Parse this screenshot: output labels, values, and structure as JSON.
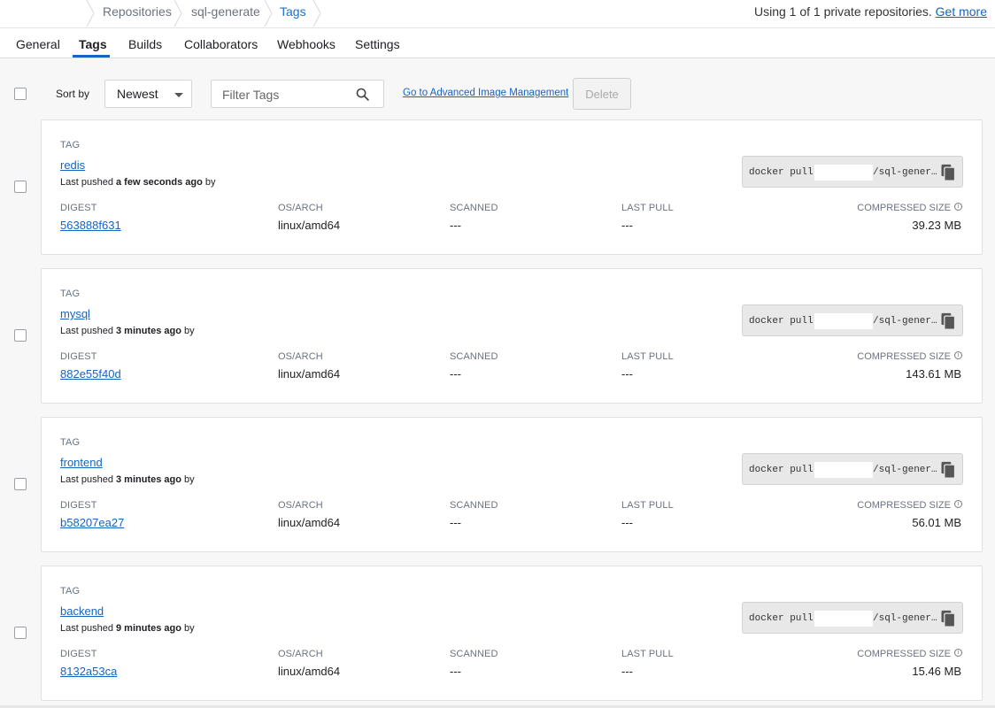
{
  "breadcrumb": {
    "items": [
      "Repositories",
      "sql-generate",
      "Tags"
    ]
  },
  "quota": {
    "text": "Using 1 of 1 private repositories.",
    "link": "Get more"
  },
  "tabs": [
    "General",
    "Tags",
    "Builds",
    "Collaborators",
    "Webhooks",
    "Settings"
  ],
  "active_tab": "Tags",
  "toolbar": {
    "sort_label": "Sort by",
    "sort_value": "Newest",
    "filter_placeholder": "Filter Tags",
    "advanced_link": "Go to Advanced Image Management",
    "delete_label": "Delete"
  },
  "labels": {
    "tag": "TAG",
    "pushed_prefix": "Last pushed",
    "pushed_suffix": "by",
    "digest": "DIGEST",
    "os_arch": "OS/ARCH",
    "scanned": "SCANNED",
    "last_pull": "LAST PULL",
    "compressed_size": "COMPRESSED SIZE",
    "pull_cmd": "docker pull",
    "pull_repo": "/sql-gener…"
  },
  "tags": [
    {
      "name": "redis",
      "pushed": "a few seconds ago",
      "digest": "563888f631",
      "os_arch": "linux/amd64",
      "scanned": "---",
      "last_pull": "---",
      "size": "39.23 MB"
    },
    {
      "name": "mysql",
      "pushed": "3 minutes ago",
      "digest": "882e55f40d",
      "os_arch": "linux/amd64",
      "scanned": "---",
      "last_pull": "---",
      "size": "143.61 MB"
    },
    {
      "name": "frontend",
      "pushed": "3 minutes ago",
      "digest": "b58207ea27",
      "os_arch": "linux/amd64",
      "scanned": "---",
      "last_pull": "---",
      "size": "56.01 MB"
    },
    {
      "name": "backend",
      "pushed": "9 minutes ago",
      "digest": "8132a53ca",
      "os_arch": "linux/amd64",
      "scanned": "---",
      "last_pull": "---",
      "size": "15.46 MB"
    }
  ],
  "colors": {
    "link": "#1565c0",
    "tab_underline": "#1565c0",
    "muted": "#6b7280",
    "page_bg": "#f7f7f7"
  },
  "icons": [
    "search-icon",
    "copy-icon",
    "info-icon",
    "chevron-down-icon"
  ]
}
